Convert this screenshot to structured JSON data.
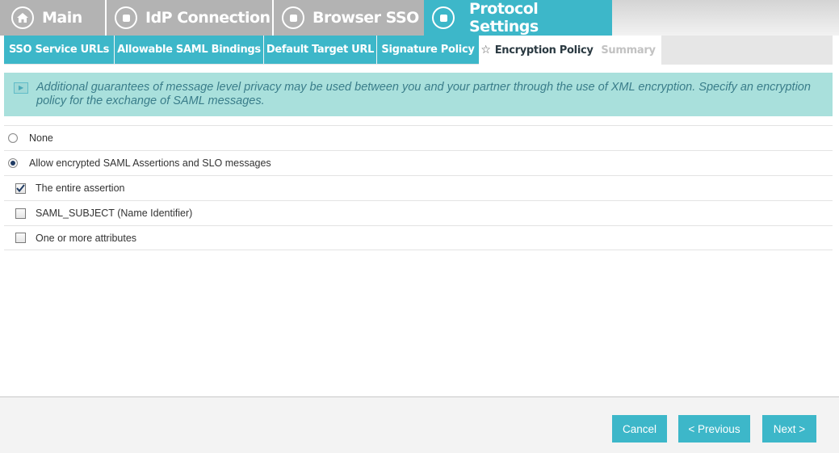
{
  "top_tabs": [
    {
      "label": "Main",
      "icon": "home-icon",
      "state": "inactive"
    },
    {
      "label": "IdP Connection",
      "icon": "square-circle-icon",
      "state": "inactive"
    },
    {
      "label": "Browser SSO",
      "icon": "square-circle-icon",
      "state": "inactive"
    },
    {
      "label": "Protocol Settings",
      "icon": "square-circle-icon",
      "state": "active"
    }
  ],
  "sub_tabs": [
    {
      "label": "SSO Service URLs",
      "state": "done"
    },
    {
      "label": "Allowable SAML Bindings",
      "state": "done"
    },
    {
      "label": "Default Target URL",
      "state": "done"
    },
    {
      "label": "Signature Policy",
      "state": "done"
    },
    {
      "label": "Encryption Policy",
      "state": "current",
      "icon": "star-icon"
    },
    {
      "label": "Summary",
      "state": "pending"
    }
  ],
  "info": {
    "icon": "info-arrow-icon",
    "text": "Additional guarantees of message level privacy may be used between you and your partner through the use of XML encryption. Specify an encryption policy for the exchange of SAML messages."
  },
  "options": {
    "radio_none": {
      "label": "None",
      "selected": false
    },
    "radio_allow": {
      "label": "Allow encrypted SAML Assertions and SLO messages",
      "selected": true
    },
    "check_entire_assertion": {
      "label": "The entire assertion",
      "checked": true
    },
    "check_saml_subject": {
      "label": "SAML_SUBJECT (Name Identifier)",
      "checked": false
    },
    "check_attributes": {
      "label": "One or more attributes",
      "checked": false
    }
  },
  "footer": {
    "cancel_label": "Cancel",
    "previous_label": "< Previous",
    "next_label": "Next >"
  },
  "colors": {
    "accent": "#3db7c9",
    "inactive_tab": "#b3b3b3",
    "info_bg": "#a9e0dc",
    "info_text": "#3a7d8a"
  }
}
